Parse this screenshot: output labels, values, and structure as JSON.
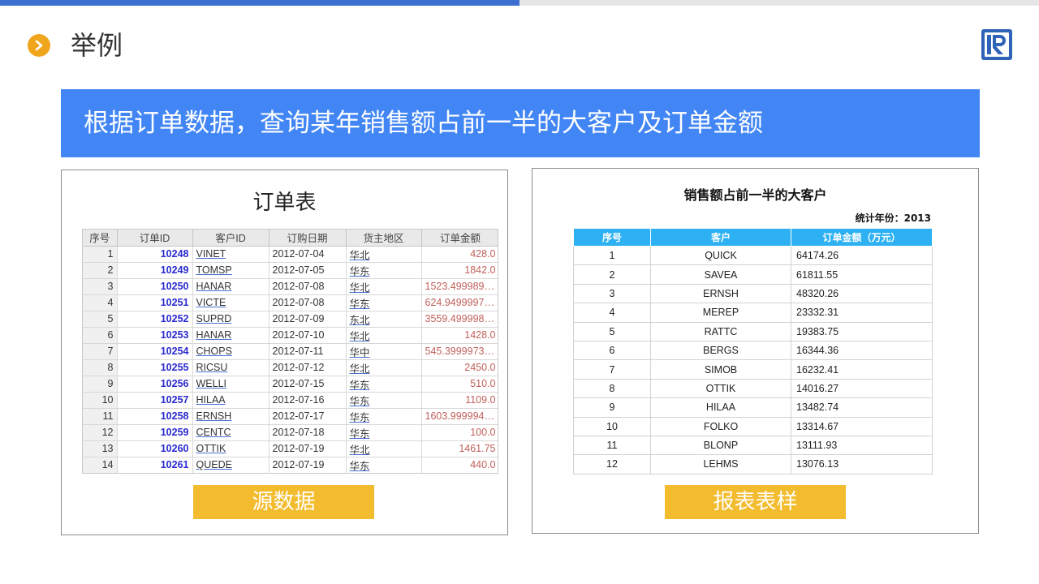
{
  "section": {
    "title": "举例"
  },
  "banner": {
    "text": "根据订单数据，查询某年销售额占前一半的大客户及订单金额"
  },
  "source": {
    "title": "订单表",
    "columns": [
      "序号",
      "订单ID",
      "客户ID",
      "订购日期",
      "货主地区",
      "订单金额"
    ],
    "rows": [
      [
        "1",
        "10248",
        "VINET",
        "2012-07-04",
        "华北",
        "428.0"
      ],
      [
        "2",
        "10249",
        "TOMSP",
        "2012-07-05",
        "华东",
        "1842.0"
      ],
      [
        "3",
        "10250",
        "HANAR",
        "2012-07-08",
        "华北",
        "1523.4999898..."
      ],
      [
        "4",
        "10251",
        "VICTE",
        "2012-07-08",
        "华东",
        "624.94999976..."
      ],
      [
        "5",
        "10252",
        "SUPRD",
        "2012-07-09",
        "东北",
        "3559.4999980..."
      ],
      [
        "6",
        "10253",
        "HANAR",
        "2012-07-10",
        "华北",
        "1428.0"
      ],
      [
        "7",
        "10254",
        "CHOPS",
        "2012-07-11",
        "华中",
        "545.39999735..."
      ],
      [
        "8",
        "10255",
        "RICSU",
        "2012-07-12",
        "华北",
        "2450.0"
      ],
      [
        "9",
        "10256",
        "WELLI",
        "2012-07-15",
        "华东",
        "510.0"
      ],
      [
        "10",
        "10257",
        "HILAA",
        "2012-07-16",
        "华东",
        "1109.0"
      ],
      [
        "11",
        "10258",
        "ERNSH",
        "2012-07-17",
        "华东",
        "1603.9999940..."
      ],
      [
        "12",
        "10259",
        "CENTC",
        "2012-07-18",
        "华东",
        "100.0"
      ],
      [
        "13",
        "10260",
        "OTTIK",
        "2012-07-19",
        "华北",
        "1461.75"
      ],
      [
        "14",
        "10261",
        "QUEDE",
        "2012-07-19",
        "华东",
        "440.0"
      ]
    ],
    "button_label": "源数据"
  },
  "report": {
    "title": "销售额占前一半的大客户",
    "year_label": "统计年份：2013",
    "columns": [
      "序号",
      "客户",
      "订单金额（万元）"
    ],
    "rows": [
      [
        "1",
        "QUICK",
        "64174.26"
      ],
      [
        "2",
        "SAVEA",
        "61811.55"
      ],
      [
        "3",
        "ERNSH",
        "48320.26"
      ],
      [
        "4",
        "MEREP",
        "23332.31"
      ],
      [
        "5",
        "RATTC",
        "19383.75"
      ],
      [
        "6",
        "BERGS",
        "16344.36"
      ],
      [
        "7",
        "SIMOB",
        "16232.41"
      ],
      [
        "8",
        "OTTIK",
        "14016.27"
      ],
      [
        "9",
        "HILAA",
        "13482.74"
      ],
      [
        "10",
        "FOLKO",
        "13314.67"
      ],
      [
        "11",
        "BLONP",
        "13111.93"
      ],
      [
        "12",
        "LEHMS",
        "13076.13"
      ]
    ],
    "button_label": "报表表样"
  },
  "icons": {
    "bullet": "chevron-right-icon",
    "logo": "r-logo-icon"
  },
  "colors": {
    "accent_blue": "#3d6fd1",
    "banner_blue": "#4286f5",
    "bullet_orange": "#f0a61c",
    "label_yellow": "#f3bc2e",
    "report_header": "#2db1f2"
  }
}
